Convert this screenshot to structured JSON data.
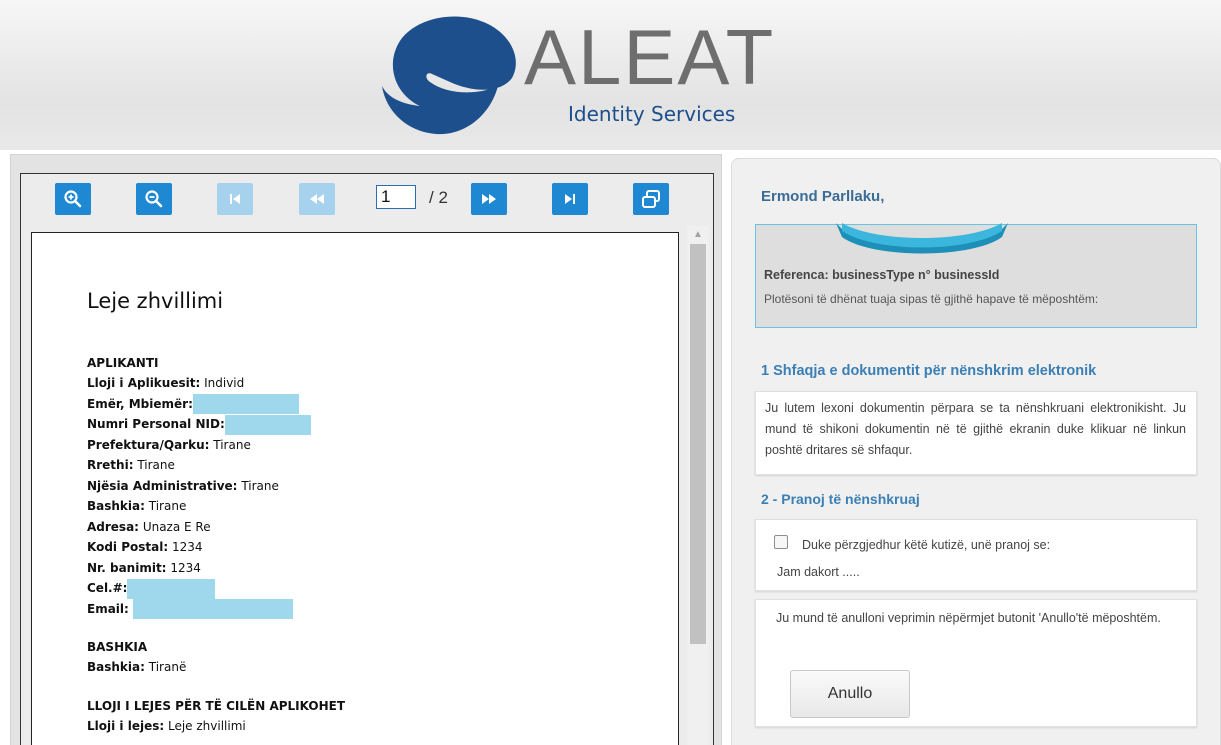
{
  "brand": {
    "name": "ALEAT",
    "tagline": "Identity Services",
    "primary_color": "#1d4f8c",
    "accent_color": "#1e88d2"
  },
  "viewer": {
    "toolbar": {
      "zoom_in_icon": "zoom-in-icon",
      "zoom_out_icon": "zoom-out-icon",
      "first_page_icon": "first-page-icon",
      "prev_page_icon": "previous-page-icon",
      "next_page_icon": "next-page-icon",
      "last_page_icon": "last-page-icon",
      "fullscreen_icon": "fullscreen-icon",
      "current_page": "1",
      "total_pages": "/ 2"
    },
    "document": {
      "title": "Leje zhvillimi",
      "applicant": {
        "heading": "APLIKANTI",
        "type_label": "Lloji i Aplikuesit:",
        "type_value": "Individ",
        "name_label": "Emër, Mbiemër:",
        "nid_label": "Numri Personal NID:",
        "prefecture_label": "Prefektura/Qarku:",
        "prefecture_value": "Tirane",
        "district_label": "Rrethi:",
        "district_value": "Tirane",
        "admin_unit_label": "Njësia Administrative:",
        "admin_unit_value": "Tirane",
        "municipality_label": "Bashkia:",
        "municipality_value": "Tirane",
        "address_label": "Adresa:",
        "address_value": "Unaza E Re",
        "postal_label": "Kodi Postal:",
        "postal_value": "1234",
        "building_label": "Nr. banimit:",
        "building_value": "1234",
        "phone_label": "Cel.#:",
        "email_label": "Email:"
      },
      "municipality": {
        "heading": "BASHKIA",
        "label": "Bashkia:",
        "value": "Tiranë"
      },
      "permit": {
        "heading": "LLOJI I LEJES PËR TË CILËN APLIKOHET",
        "type_label": "Lloji i lejes:",
        "type_value": "Leje zhvillimi"
      }
    }
  },
  "side": {
    "greeting": "Ermond Parllaku,",
    "reference": "Referenca: businessType n° businessId",
    "instructions": "Plotësoni të dhënat tuaja sipas të gjithë hapave të mëposhtëm:",
    "step1": {
      "title": "1  Shfaqja e dokumentit për nënshkrim elektronik",
      "text": "Ju lutem lexoni dokumentin përpara se ta nënshkruani elektronikisht. Ju mund të shikoni dokumentin në të gjithë ekranin duke klikuar në linkun poshtë dritares së shfaqur."
    },
    "step2": {
      "title": "2 - Pranoj të nënshkruaj",
      "checkbox_label": "Duke përzgjedhur këtë kutizë, unë pranoj se:",
      "agree_text": "Jam dakort .....",
      "cancel_info": "Ju mund të anulloni veprimin nëpërmjet butonit 'Anullo'të mëposhtëm.",
      "cancel_label": "Anullo"
    }
  }
}
